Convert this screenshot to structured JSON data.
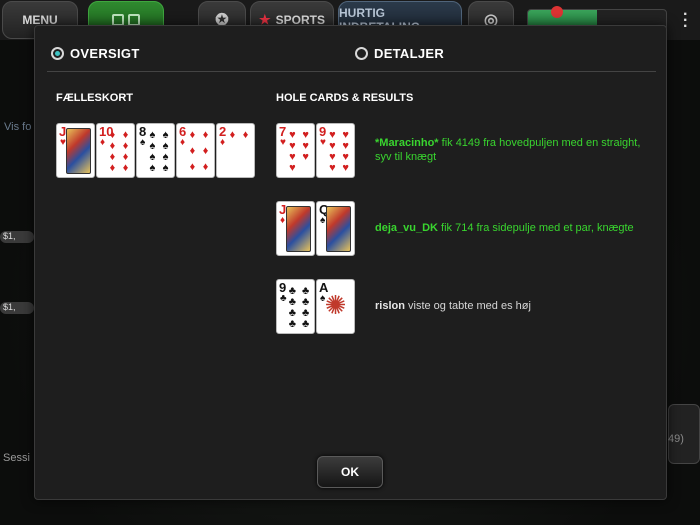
{
  "topbar": {
    "menu_label": "MENU",
    "sports_label": "SPORTS",
    "deposit_label": "HURTIG INDBETALING"
  },
  "background": {
    "side_link": "Vis fo",
    "chip_1": "$1,",
    "chip_2": "$1,",
    "session_label": "Sessi",
    "right_amount": "49)"
  },
  "modal": {
    "tabs": [
      {
        "label": "OVERSIGT",
        "selected": true
      },
      {
        "label": "DETALJER",
        "selected": false
      }
    ],
    "community_title": "FÆLLESKORT",
    "hole_title": "HOLE CARDS & RESULTS",
    "community_cards": [
      {
        "rank": "J",
        "suit": "♥",
        "color": "red",
        "face": true
      },
      {
        "rank": "10",
        "suit": "♦",
        "color": "red",
        "face": false
      },
      {
        "rank": "8",
        "suit": "♠",
        "color": "blk",
        "face": false
      },
      {
        "rank": "6",
        "suit": "♦",
        "color": "red",
        "face": false
      },
      {
        "rank": "2",
        "suit": "♦",
        "color": "red",
        "face": false
      }
    ],
    "players": [
      {
        "cards": [
          {
            "rank": "7",
            "suit": "♥",
            "color": "red",
            "face": false
          },
          {
            "rank": "9",
            "suit": "♥",
            "color": "red",
            "face": false
          }
        ],
        "name": "*Maracinho*",
        "text": " fik 4149 fra hovedpuljen med en straight, syv til knægt"
      },
      {
        "cards": [
          {
            "rank": "J",
            "suit": "♦",
            "color": "red",
            "face": true
          },
          {
            "rank": "Q",
            "suit": "♠",
            "color": "blk",
            "face": true
          }
        ],
        "name": "deja_vu_DK",
        "text": " fik 714 fra sidepulje med et par, knægte"
      },
      {
        "cards": [
          {
            "rank": "9",
            "suit": "♣",
            "color": "blk",
            "face": false
          },
          {
            "rank": "A",
            "suit": "♠",
            "color": "blk",
            "face": false
          }
        ],
        "name": "rislon",
        "text": " viste og tabte med es høj"
      }
    ],
    "ok_label": "OK"
  },
  "colors": {
    "winner_text": "#39d52f",
    "radio_selected": "#3fc3c3",
    "modal_bg": "#1e1e1e"
  }
}
